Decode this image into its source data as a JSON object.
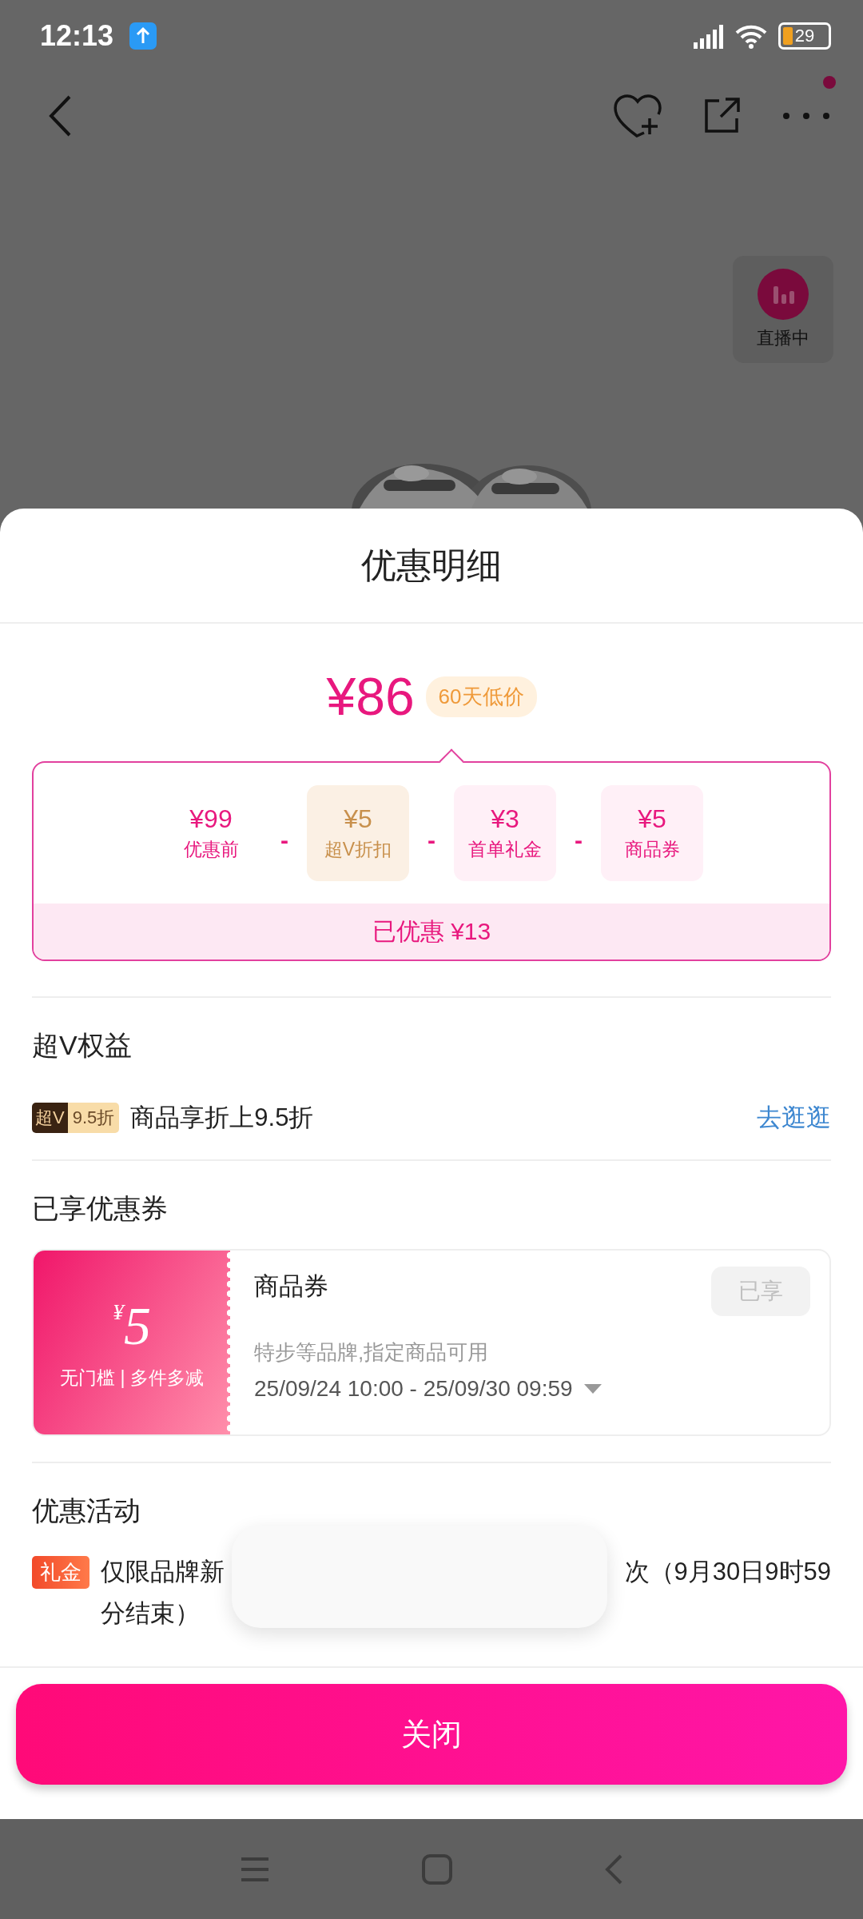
{
  "status_bar": {
    "time": "12:13",
    "battery": "29"
  },
  "header": {
    "notification_dot": true
  },
  "live": {
    "label": "直播中"
  },
  "sheet": {
    "title": "优惠明细"
  },
  "price": {
    "amount": "¥86",
    "tag": "60天低价"
  },
  "breakdown": {
    "items": [
      {
        "amount": "¥99",
        "label": "优惠前",
        "kind": "base"
      },
      {
        "operator": "-",
        "amount": "¥5",
        "label": "超V折扣",
        "kind": "vip"
      },
      {
        "operator": "-",
        "amount": "¥3",
        "label": "首单礼金",
        "kind": "gift"
      },
      {
        "operator": "-",
        "amount": "¥5",
        "label": "商品券",
        "kind": "coupon"
      }
    ],
    "total": "已优惠 ¥13"
  },
  "vip": {
    "title": "超V权益",
    "badge_logo": "超V",
    "badge_discount": "9.5折",
    "text": "商品享折上9.5折",
    "link": "去逛逛"
  },
  "coupons": {
    "title": "已享优惠券",
    "items": [
      {
        "currency": "¥",
        "value": "5",
        "condition": "无门槛 | 多件多减",
        "name": "商品券",
        "status": "已享",
        "disabled": true,
        "scope": "特步等品牌,指定商品可用",
        "period": "25/09/24 10:00 - 25/09/30 09:59"
      }
    ]
  },
  "activities": {
    "title": "优惠活动",
    "items": [
      {
        "tag": "礼金",
        "line_1_start": "仅限品牌新",
        "line_1_end": "次（9月30日9时59",
        "line_2": "分结束）"
      }
    ]
  },
  "close_button": "关闭"
}
